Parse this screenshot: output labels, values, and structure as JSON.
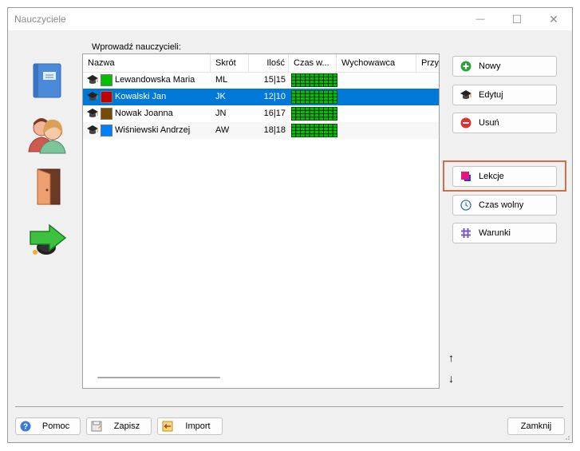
{
  "window": {
    "title": "Nauczyciele",
    "minimize_glyph": "—",
    "maximize_glyph": "☐",
    "close_glyph": "✕"
  },
  "sidebar": {
    "icons": [
      "notebook-icon",
      "teachers-icon",
      "door-icon",
      "exit-arrow-icon"
    ]
  },
  "prompt": "Wprowadź nauczycieli:",
  "grid": {
    "columns": [
      "Nazwa",
      "Skrót",
      "Ilość",
      "Czas w...",
      "Wychowawca",
      "Przy"
    ],
    "rows": [
      {
        "name": "Lewandowska Maria",
        "short": "ML",
        "count": "15|15",
        "color": "#00c000",
        "selected": false
      },
      {
        "name": "Kowalski Jan",
        "short": "JK",
        "count": "12|10",
        "color": "#c00000",
        "selected": true
      },
      {
        "name": "Nowak Joanna",
        "short": "JN",
        "count": "16|17",
        "color": "#7a4a00",
        "selected": false
      },
      {
        "name": "Wiśniewski Andrzej",
        "short": "AW",
        "count": "18|18",
        "color": "#0080ff",
        "selected": false
      }
    ]
  },
  "actions": {
    "new_label": "Nowy",
    "edit_label": "Edytuj",
    "delete_label": "Usuń",
    "lessons_label": "Lekcje",
    "free_time_label": "Czas wolny",
    "conditions_label": "Warunki",
    "up_glyph": "↑",
    "down_glyph": "↓"
  },
  "footer": {
    "help_label": "Pomoc",
    "save_label": "Zapisz",
    "import_label": "Import",
    "close_label": "Zamknij"
  },
  "colors": {
    "selection": "#0078d7",
    "highlight_border": "#c8734b",
    "timegrid_green": "#00c000"
  }
}
